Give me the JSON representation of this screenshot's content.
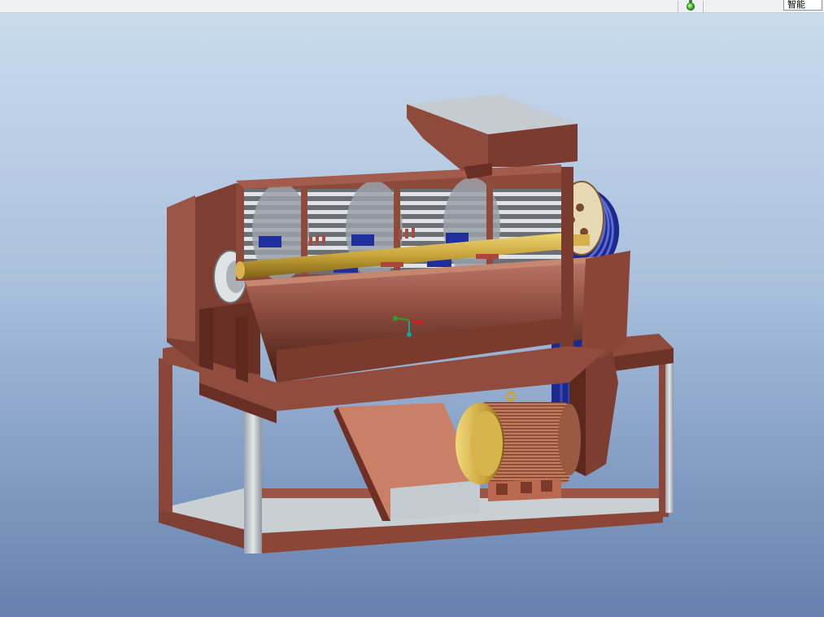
{
  "status_bar": {
    "status_light_icon": "green-status-light-icon",
    "filter_value": "智能"
  },
  "viewport": {
    "model_icon": "cad-assembly-model",
    "csys_icon": "coordinate-system-triad-icon",
    "colors": {
      "background_top": "#c9dbed",
      "background_bottom": "#6681ad",
      "housing": "#7c3f33",
      "shaft": "#c9a43a",
      "screen_bars": "#d9dde2",
      "belt": "#1e2a8a",
      "motor": "#c07a5a"
    }
  }
}
